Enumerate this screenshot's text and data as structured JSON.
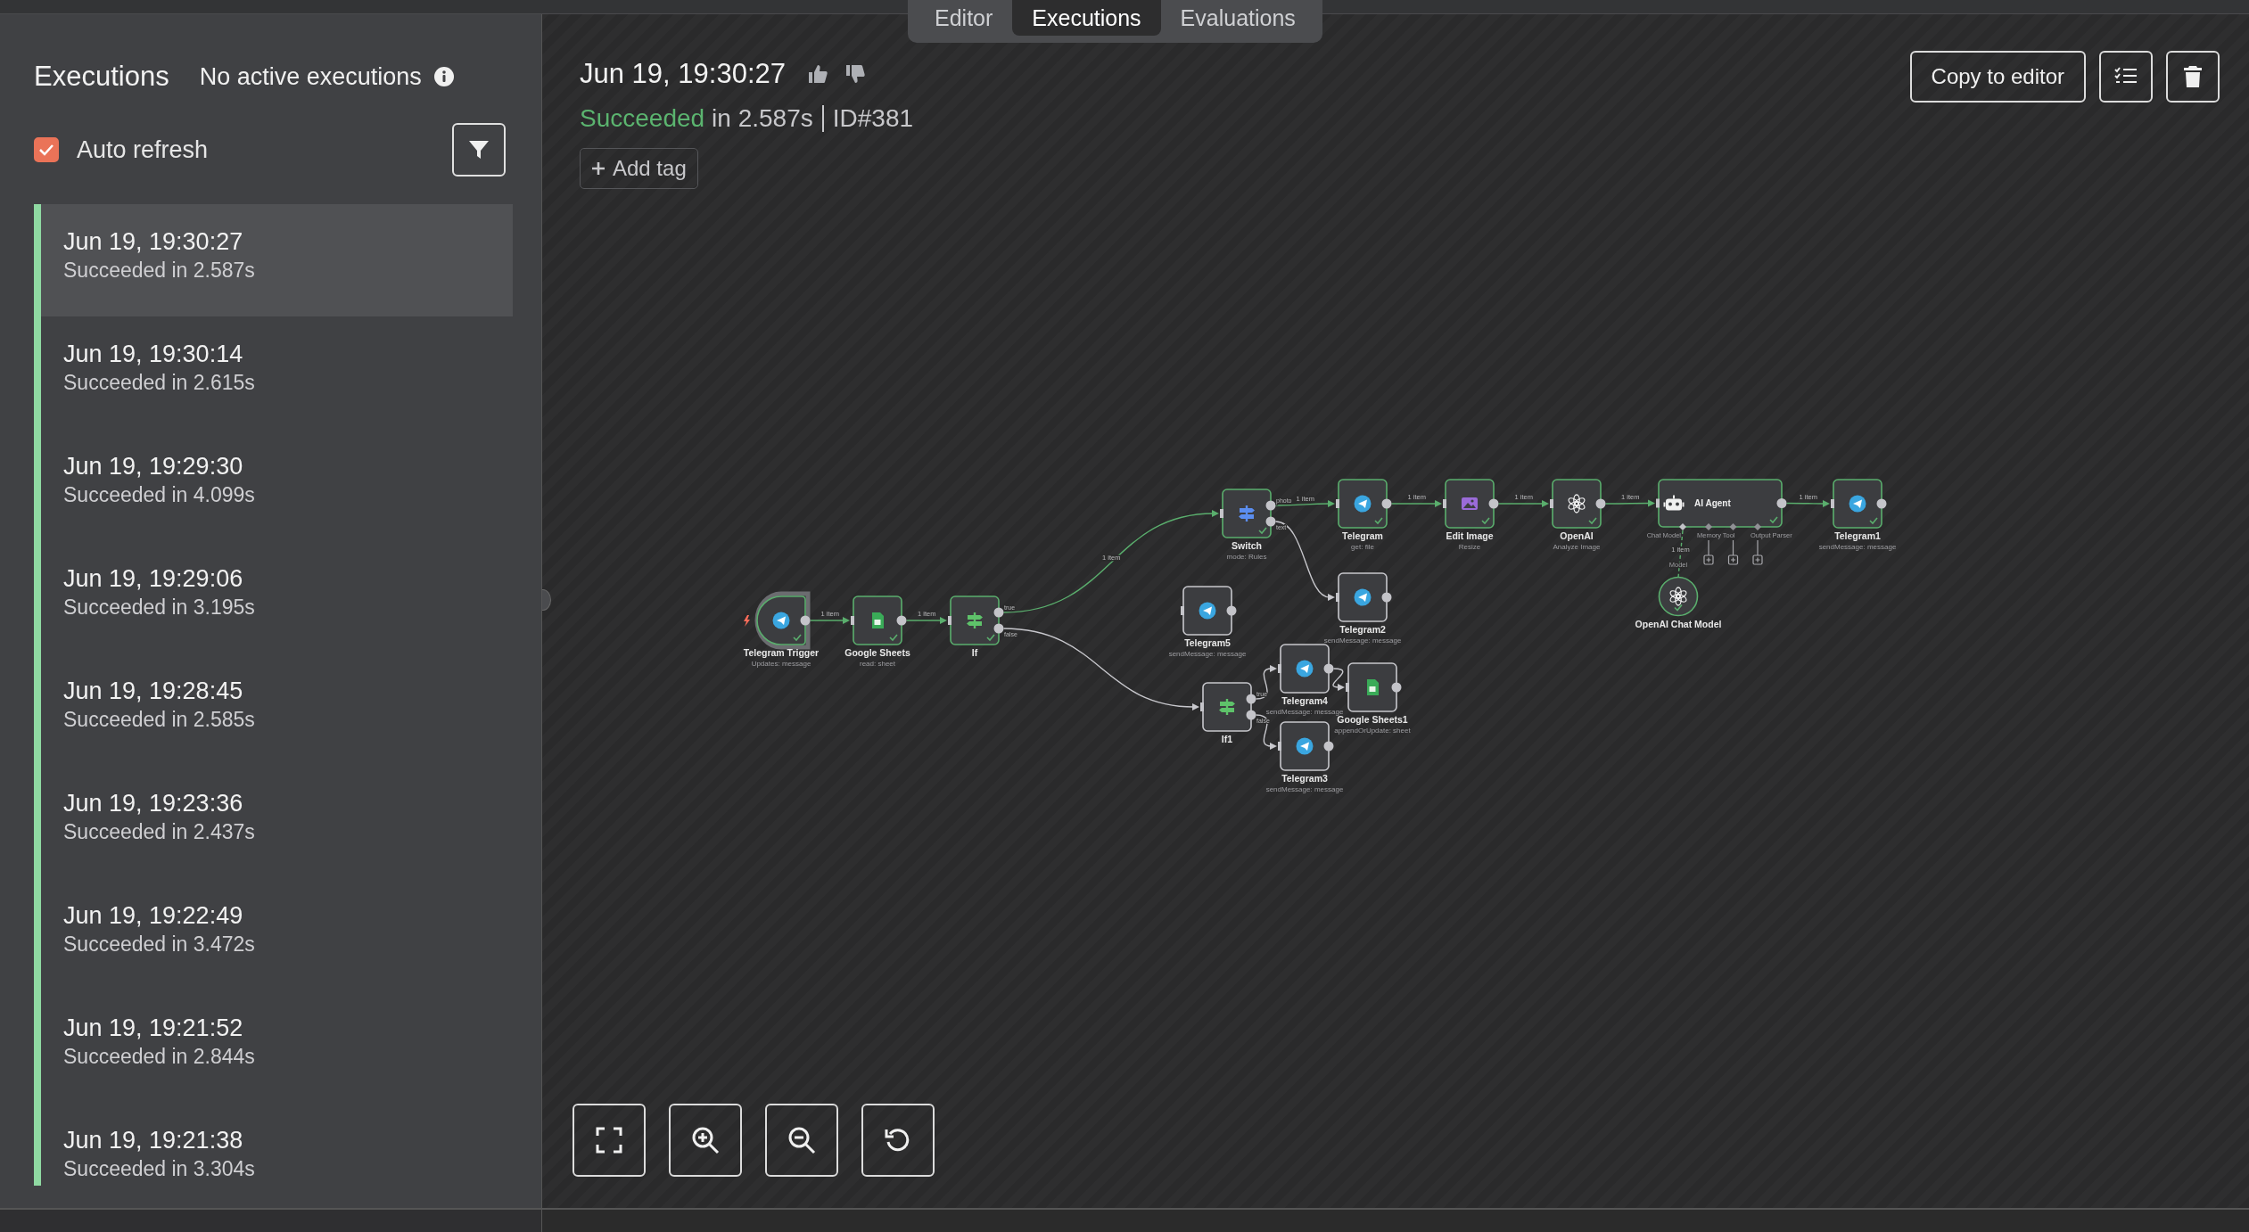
{
  "tabs": [
    {
      "label": "Editor",
      "selected": false
    },
    {
      "label": "Executions",
      "selected": true
    },
    {
      "label": "Evaluations",
      "selected": false
    }
  ],
  "sidebar": {
    "title": "Executions",
    "status": "No active executions",
    "auto_refresh": {
      "label": "Auto refresh",
      "checked": true
    },
    "executions": [
      {
        "time": "Jun 19, 19:30:27",
        "status": "Succeeded in 2.587s",
        "selected": true
      },
      {
        "time": "Jun 19, 19:30:14",
        "status": "Succeeded in 2.615s",
        "selected": false
      },
      {
        "time": "Jun 19, 19:29:30",
        "status": "Succeeded in 4.099s",
        "selected": false
      },
      {
        "time": "Jun 19, 19:29:06",
        "status": "Succeeded in 3.195s",
        "selected": false
      },
      {
        "time": "Jun 19, 19:28:45",
        "status": "Succeeded in 2.585s",
        "selected": false
      },
      {
        "time": "Jun 19, 19:23:36",
        "status": "Succeeded in 2.437s",
        "selected": false
      },
      {
        "time": "Jun 19, 19:22:49",
        "status": "Succeeded in 3.472s",
        "selected": false
      },
      {
        "time": "Jun 19, 19:21:52",
        "status": "Succeeded in 2.844s",
        "selected": false
      },
      {
        "time": "Jun 19, 19:21:38",
        "status": "Succeeded in 3.304s",
        "selected": false
      }
    ]
  },
  "execution": {
    "title": "Jun 19, 19:30:27",
    "status": "Succeeded",
    "duration": "in 2.587s",
    "id": "ID#381",
    "add_tag": "Add tag",
    "copy_button": "Copy to editor"
  },
  "workflow": {
    "nodes": [
      {
        "name": "Telegram Trigger",
        "subtitle": "Updates: message",
        "kind": "trigger",
        "executed": true
      },
      {
        "name": "Google Sheets",
        "subtitle": "read: sheet",
        "kind": "sheets",
        "executed": true
      },
      {
        "name": "If",
        "kind": "if",
        "outputs": [
          "true",
          "false"
        ],
        "executed": true
      },
      {
        "name": "Switch",
        "subtitle": "mode: Rules",
        "kind": "switch",
        "outputs": [
          "photo",
          "text"
        ],
        "executed": true
      },
      {
        "name": "Telegram",
        "subtitle": "get: file",
        "kind": "telegram",
        "executed": true
      },
      {
        "name": "Edit Image",
        "subtitle": "Resize",
        "kind": "image",
        "executed": true
      },
      {
        "name": "OpenAI",
        "subtitle": "Analyze Image",
        "kind": "openai",
        "executed": true
      },
      {
        "name": "AI Agent",
        "kind": "agent",
        "executed": true,
        "inputs": [
          {
            "label": "Chat Model",
            "connected": true
          },
          {
            "label": "Memory",
            "connected": false
          },
          {
            "label": "Tool",
            "connected": false
          },
          {
            "label": "Output Parser",
            "connected": false
          }
        ]
      },
      {
        "name": "Telegram1",
        "subtitle": "sendMessage: message",
        "kind": "telegram",
        "executed": true
      },
      {
        "name": "OpenAI Chat Model",
        "kind": "model",
        "outputs": [
          "Model"
        ],
        "executed": true
      },
      {
        "name": "Telegram2",
        "subtitle": "sendMessage: message",
        "kind": "telegram",
        "executed": false
      },
      {
        "name": "Telegram5",
        "subtitle": "sendMessage: message",
        "kind": "telegram",
        "executed": false
      },
      {
        "name": "If1",
        "kind": "if",
        "outputs": [
          "true",
          "false"
        ],
        "executed": false
      },
      {
        "name": "Telegram4",
        "subtitle": "sendMessage: message",
        "kind": "telegram",
        "executed": false
      },
      {
        "name": "Google Sheets1",
        "subtitle": "appendOrUpdate: sheet",
        "kind": "sheets",
        "executed": false
      },
      {
        "name": "Telegram3",
        "subtitle": "sendMessage: message",
        "kind": "telegram",
        "executed": false
      }
    ],
    "connections": [
      {
        "label": "1 item",
        "executed": true
      },
      {
        "label": "1 item",
        "executed": true
      },
      {
        "label": "1 item",
        "executed": true
      },
      {
        "label": "1 item",
        "executed": true
      },
      {
        "label": "1 item",
        "executed": true
      },
      {
        "label": "1 item",
        "executed": true
      },
      {
        "label": "1 item",
        "executed": true
      },
      {
        "label": "1 item",
        "executed": true
      },
      {
        "label": "1 item",
        "executed": true
      },
      {
        "executed": false
      },
      {
        "executed": false
      },
      {
        "executed": false
      },
      {
        "executed": false
      },
      {
        "executed": false
      }
    ]
  }
}
